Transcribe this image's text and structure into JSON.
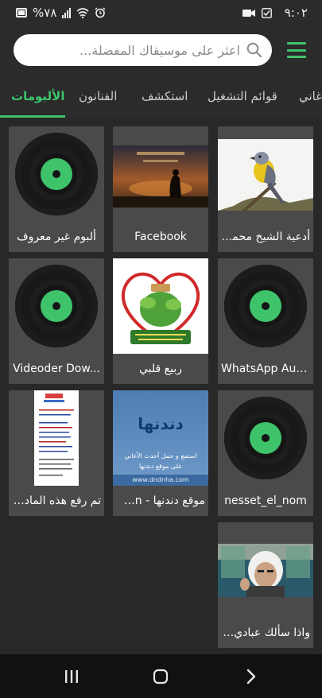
{
  "status": {
    "time": "٩:٠٢",
    "battery": "%٧٨"
  },
  "search": {
    "placeholder": "اعثر على موسيقاك المفضلة..."
  },
  "tabs": [
    {
      "label": "الألبومات"
    },
    {
      "label": "الفنانون"
    },
    {
      "label": "استكشف"
    },
    {
      "label": "قوائم التشغيل"
    },
    {
      "label": "أغاني"
    }
  ],
  "albums": [
    {
      "title": "أدعية الشيخ محمد...",
      "art": "bird-photo"
    },
    {
      "title": "Facebook",
      "art": "sunset-prayer-photo"
    },
    {
      "title": "ألبوم غير معروف",
      "art": "vinyl-placeholder"
    },
    {
      "title": "WhatsApp Audio",
      "art": "vinyl-placeholder"
    },
    {
      "title": "ربيع قلبي",
      "art": "heart-quran-image"
    },
    {
      "title": "Videoder Dow...",
      "art": "vinyl-placeholder"
    },
    {
      "title": "nesset_el_nom",
      "art": "vinyl-placeholder"
    },
    {
      "title": "موقع دندنها - Dn...",
      "art": "dndnha-banner"
    },
    {
      "title": "تم رفع هذه المادة ب...",
      "art": "document-scan"
    },
    {
      "title": "واذا سألك عبادي ع...",
      "art": "reciter-photo"
    }
  ],
  "art_text": {
    "dndnha_logo": "دندنها",
    "dndnha_line1": "استمع و حمل أحدث الأغاني",
    "dndnha_line2": "على موقع دندنها",
    "dndnha_url": "www.dndnha.com"
  },
  "colors": {
    "accent": "#3ec36b",
    "background": "#282828",
    "card": "#4a4a4a"
  }
}
